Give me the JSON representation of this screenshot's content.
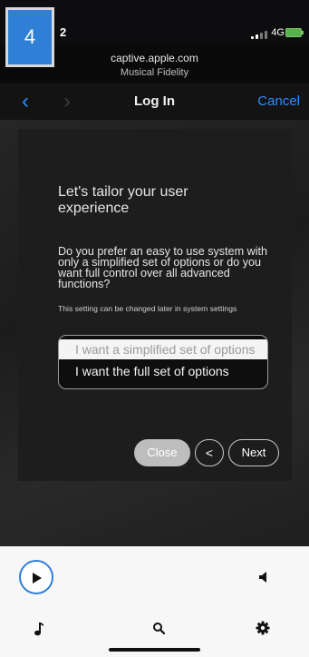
{
  "step_badge": "4",
  "status_bar": {
    "time": "2",
    "network": "4G"
  },
  "browser": {
    "url": "captive.apple.com",
    "site_name": "Musical Fidelity"
  },
  "nav": {
    "back": "‹",
    "forward": "›",
    "title": "Log In",
    "cancel": "Cancel"
  },
  "dialog": {
    "headline": "Let's tailor your user experience",
    "question": "Do you prefer an easy to use system with only a simplified set of options or do you want full control over all advanced functions?",
    "hint": "This setting can be changed later in system settings",
    "options": [
      {
        "label": "I want a simplified set of options",
        "selected": true
      },
      {
        "label": "I want the full set of options",
        "selected": false
      }
    ],
    "buttons": {
      "close": "Close",
      "previous": "<",
      "next": "Next"
    }
  },
  "player": {
    "play_icon": "play-icon",
    "volume_icon": "volume-icon"
  },
  "tab_bar": {
    "icons": [
      "music-note-icon",
      "search-icon",
      "gear-icon"
    ]
  },
  "colors": {
    "accent": "#2f8cff",
    "badge": "#2f7fd6",
    "battery": "#55b449"
  }
}
